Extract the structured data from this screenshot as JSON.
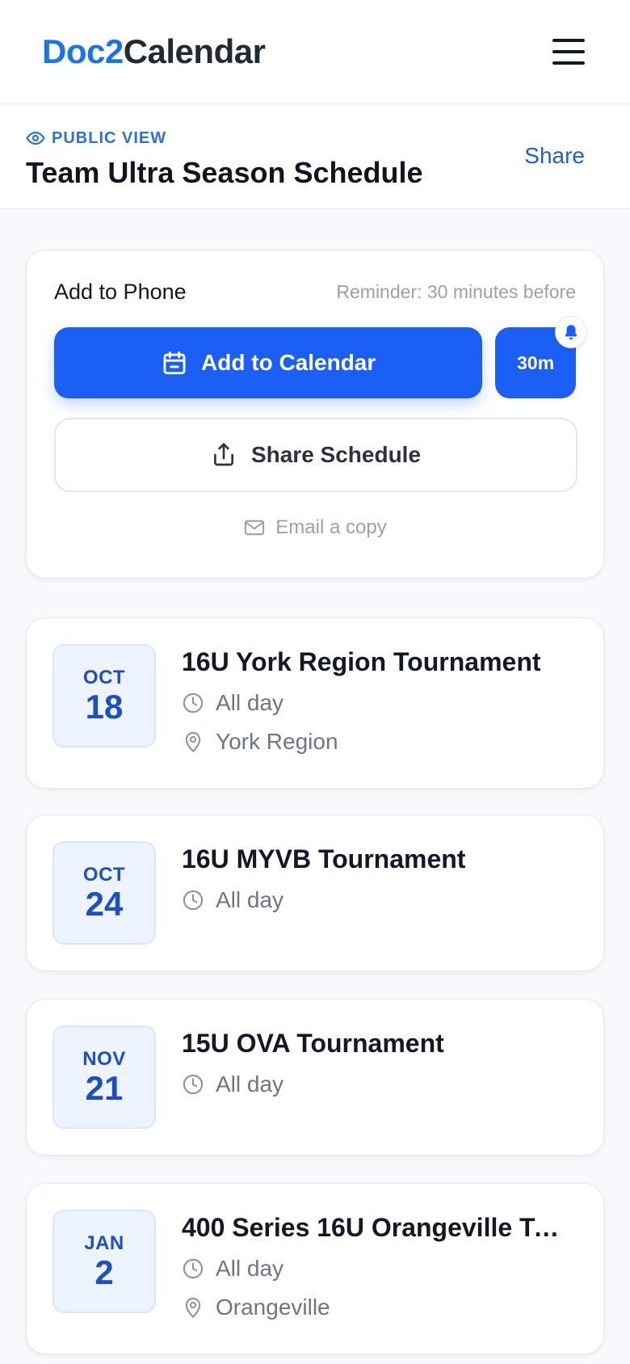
{
  "header": {
    "logo_part1": "Doc2",
    "logo_part2": "Calendar"
  },
  "subheader": {
    "badge": "PUBLIC VIEW",
    "title": "Team Ultra Season Schedule",
    "share_label": "Share"
  },
  "action_card": {
    "title": "Add to Phone",
    "reminder": "Reminder: 30 minutes before",
    "add_label": "Add to Calendar",
    "reminder_button": "30m",
    "share_schedule_label": "Share Schedule",
    "email_label": "Email a copy"
  },
  "events": [
    {
      "month": "OCT",
      "day": "18",
      "title": "16U York Region Tournament",
      "time": "All day",
      "location": "York Region"
    },
    {
      "month": "OCT",
      "day": "24",
      "title": "16U MYVB Tournament",
      "time": "All day",
      "location": ""
    },
    {
      "month": "NOV",
      "day": "21",
      "title": "15U OVA Tournament",
      "time": "All day",
      "location": ""
    },
    {
      "month": "JAN",
      "day": "2",
      "title": "400 Series 16U Orangeville To...",
      "time": "All day",
      "location": "Orangeville"
    }
  ],
  "colors": {
    "primary": "#1b5ff5",
    "brand_blue": "#1a73e8",
    "date_text": "#1c4fc6"
  }
}
